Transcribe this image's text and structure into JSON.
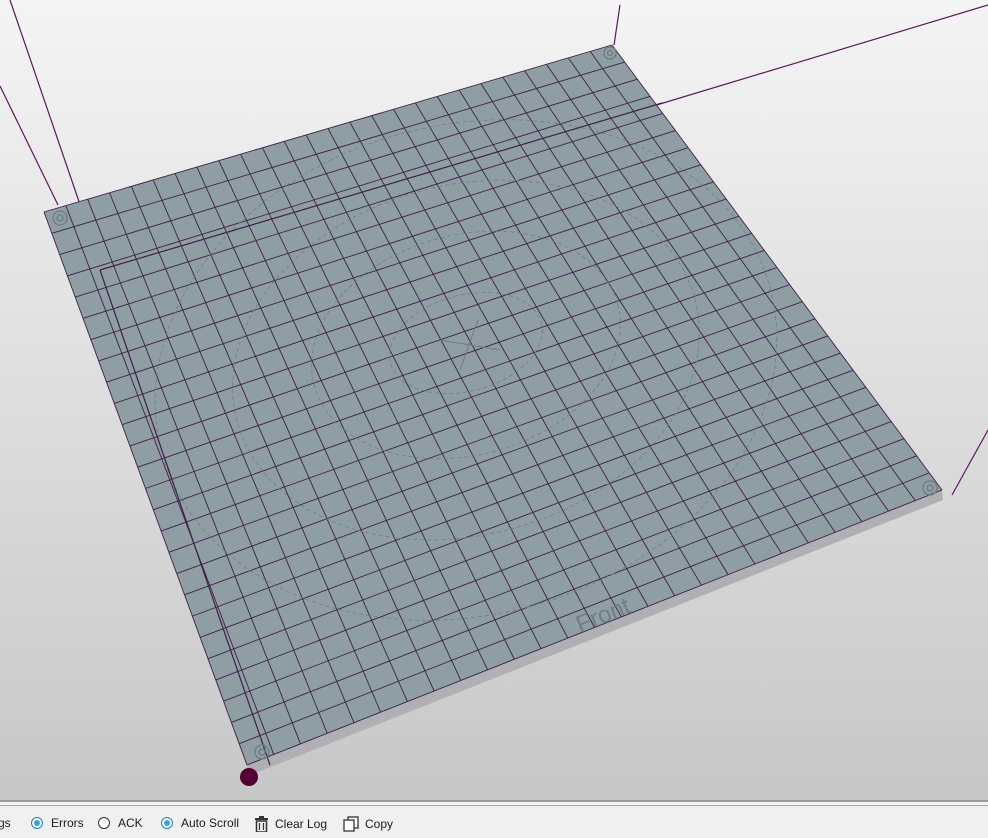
{
  "viewport": {
    "colors": {
      "bed": "#8e9ea3",
      "bed_edge": "#b0afb3",
      "grid": "#3f1f4a",
      "frame": "#5a1a5e",
      "origin_marker": "#550035",
      "bed_circles": "#6e7e83"
    },
    "bed_label": "Front"
  },
  "log_toolbar": {
    "items": [
      {
        "label": "gs",
        "icon": "radio-icon",
        "checked": true
      },
      {
        "label": "Errors",
        "icon": "radio-icon",
        "checked": true
      },
      {
        "label": "ACK",
        "icon": "radio-icon",
        "checked": false
      },
      {
        "label": "Auto Scroll",
        "icon": "radio-icon",
        "checked": true
      },
      {
        "label": "Clear Log",
        "icon": "trash-icon"
      },
      {
        "label": "Copy",
        "icon": "copy-icon"
      }
    ]
  }
}
